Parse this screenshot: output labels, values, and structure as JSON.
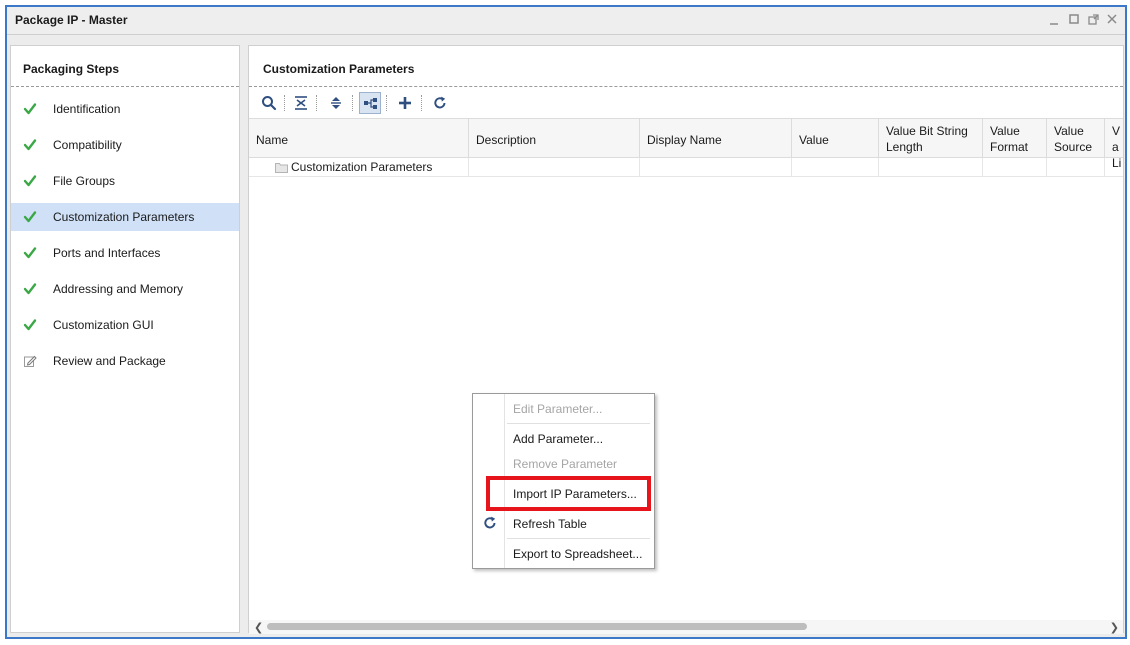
{
  "window": {
    "title": "Package IP - Master"
  },
  "left_panel": {
    "title": "Packaging Steps",
    "steps": [
      {
        "label": "Identification",
        "icon": "check-icon"
      },
      {
        "label": "Compatibility",
        "icon": "check-icon"
      },
      {
        "label": "File Groups",
        "icon": "check-icon"
      },
      {
        "label": "Customization Parameters",
        "icon": "check-icon",
        "selected": true
      },
      {
        "label": "Ports and Interfaces",
        "icon": "check-icon"
      },
      {
        "label": "Addressing and Memory",
        "icon": "check-icon"
      },
      {
        "label": "Customization GUI",
        "icon": "check-icon"
      },
      {
        "label": "Review and Package",
        "icon": "edit-icon"
      }
    ]
  },
  "right_panel": {
    "title": "Customization Parameters",
    "columns": [
      "Name",
      "Description",
      "Display Name",
      "Value",
      "Value Bit String Length",
      "Value Format",
      "Value Source",
      "Va Li"
    ],
    "rows": [
      {
        "name": "Customization Parameters"
      }
    ]
  },
  "context_menu": {
    "items": [
      {
        "label": "Edit Parameter...",
        "enabled": false
      },
      {
        "label": "Add Parameter...",
        "enabled": true
      },
      {
        "label": "Remove Parameter",
        "enabled": false
      },
      {
        "label": "Import IP Parameters...",
        "enabled": true,
        "highlighted": true
      },
      {
        "label": "Refresh Table",
        "enabled": true,
        "icon": "refresh-icon"
      },
      {
        "label": "Export to Spreadsheet...",
        "enabled": true
      }
    ]
  },
  "colors": {
    "accent": "#3c78c8",
    "check": "#3aa845",
    "selection": "#cfe0f7",
    "highlight": "#e8141b"
  }
}
